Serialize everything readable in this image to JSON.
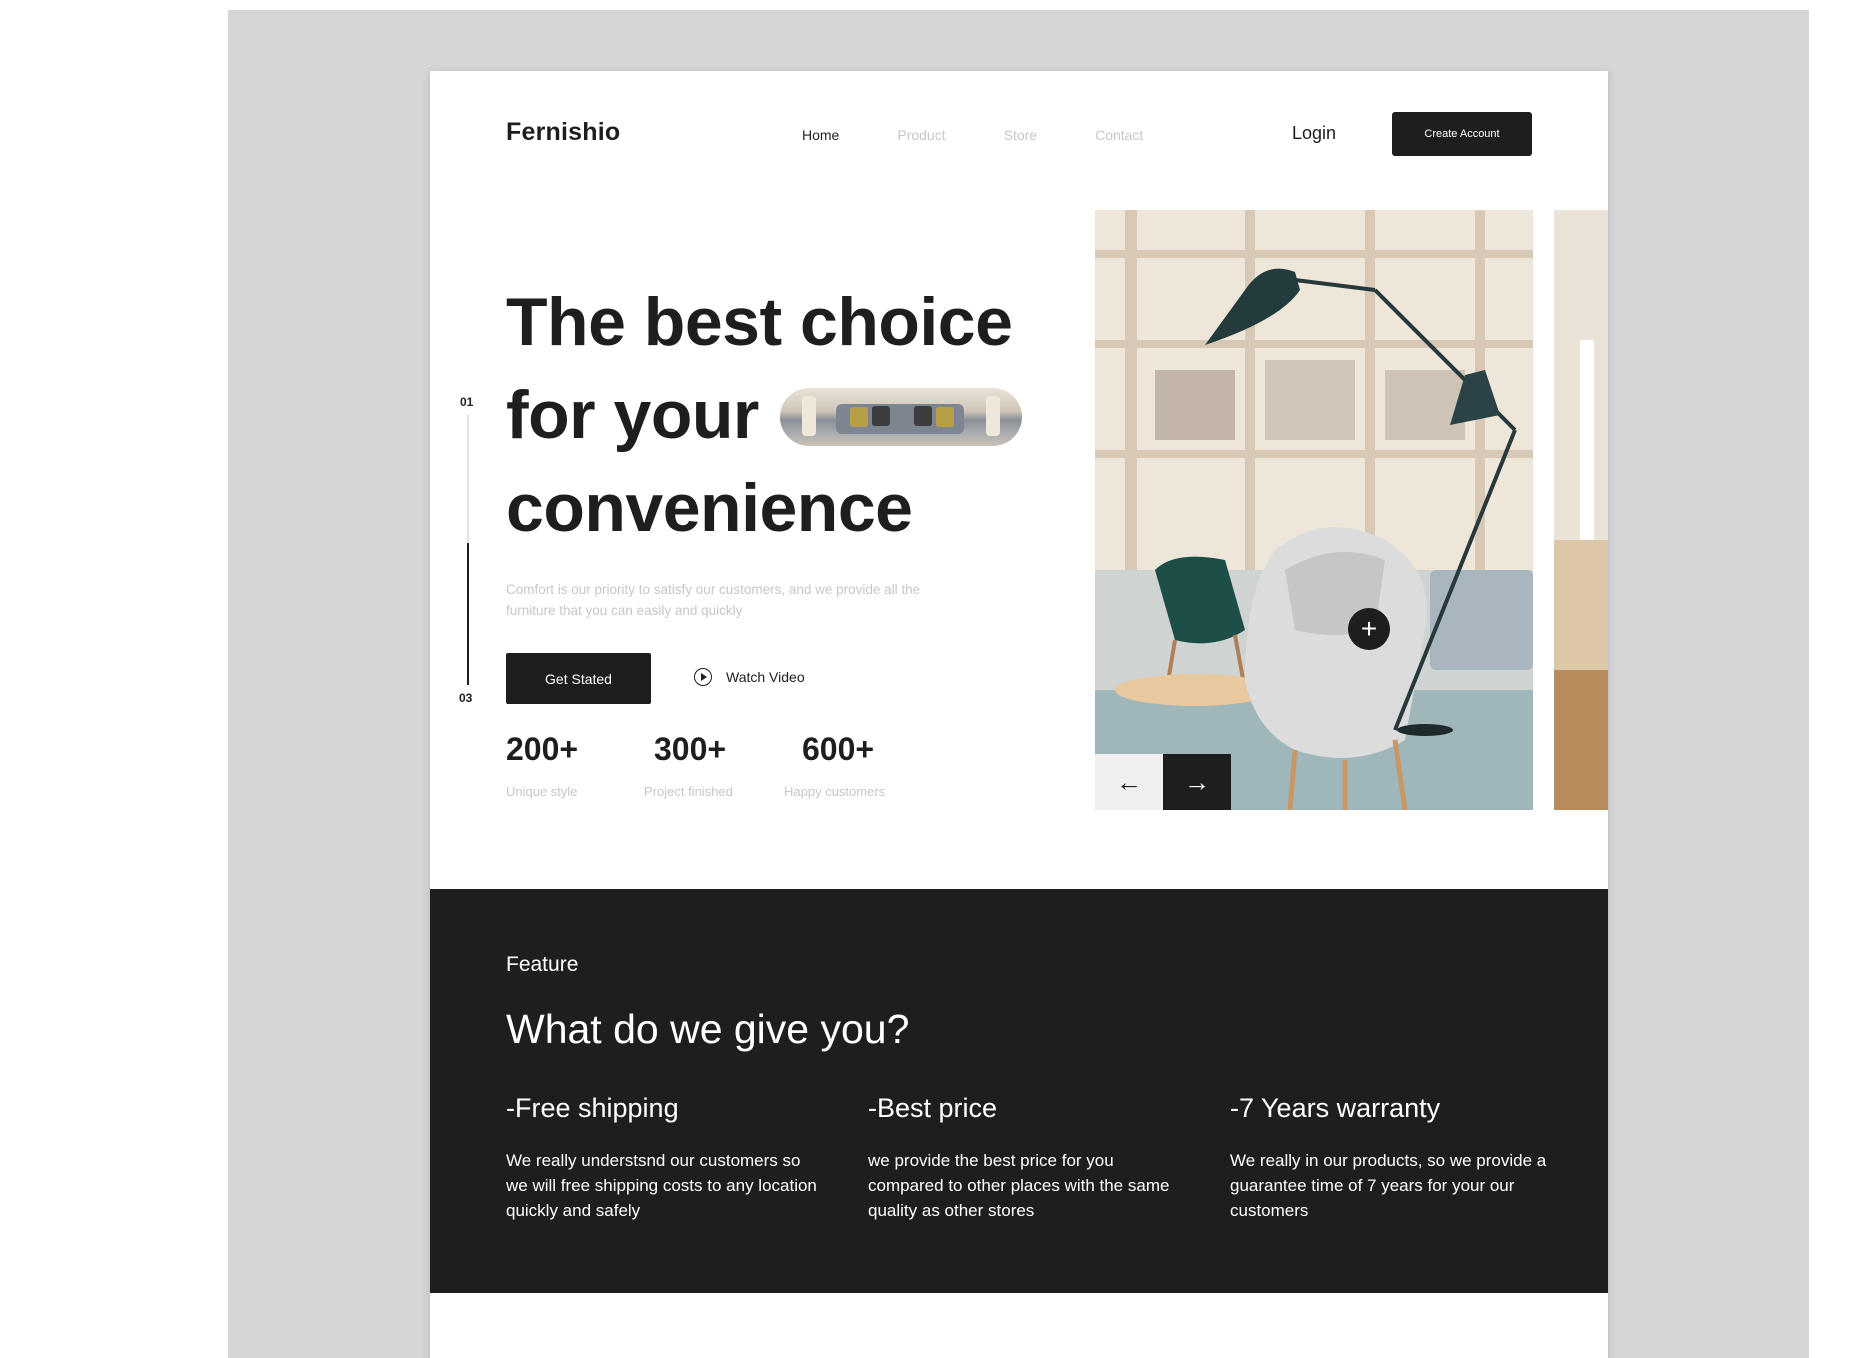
{
  "brand": "Fernishio",
  "nav": {
    "links": [
      "Home",
      "Product",
      "Store",
      "Contact"
    ],
    "active": "Home",
    "login": "Login",
    "create_account": "Create Account"
  },
  "hero": {
    "title_lines": [
      "The best choice",
      "for your",
      "convenience"
    ],
    "slide_start": "01",
    "slide_end": "03",
    "description": "Comfort is our priority to satisfy our customers, and we provide all the furniture that you can easily and quickly",
    "cta_primary": "Get Stated",
    "cta_secondary": "Watch Video",
    "stats": [
      {
        "value": "200+",
        "label": "Unique style"
      },
      {
        "value": "300+",
        "label": "Project finished"
      },
      {
        "value": "600+",
        "label": "Happy customers"
      }
    ]
  },
  "gallery": {
    "prev_icon": "arrow-left-icon",
    "next_icon": "arrow-right-icon",
    "hotspot_icon": "plus-icon"
  },
  "feature": {
    "tag": "Feature",
    "heading": "What do we give you?",
    "items": [
      {
        "title": "-Free shipping",
        "text": "We really understsnd our customers so we will free shipping costs to any location quickly and safely"
      },
      {
        "title": "-Best price",
        "text": "we provide the best price for you compared to other places with the same quality as other stores"
      },
      {
        "title": "-7 Years warranty",
        "text": "We really in our products, so we provide a guarantee time of 7 years for your our customers"
      }
    ]
  },
  "colors": {
    "dark": "#1e1e1e",
    "muted": "#c7c7c7",
    "canvas": "#d6d6d8"
  }
}
